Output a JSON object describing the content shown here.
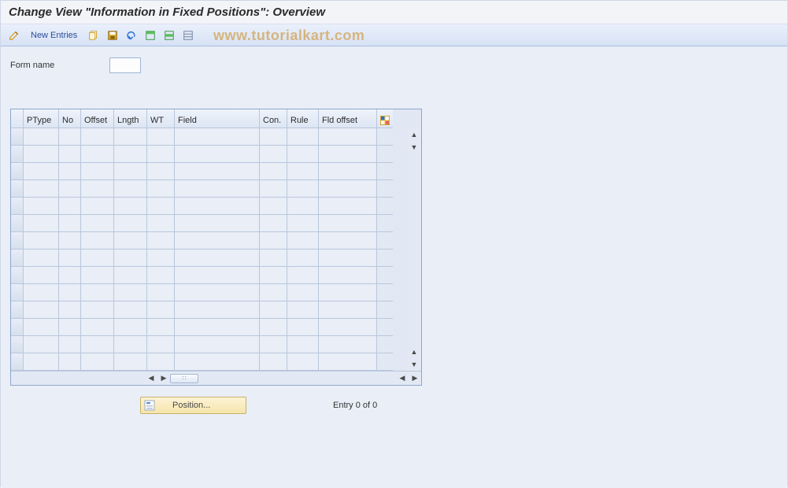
{
  "title": "Change View \"Information in Fixed Positions\": Overview",
  "watermark": "www.tutorialkart.com",
  "toolbar": {
    "new_entries_label": "New Entries"
  },
  "form": {
    "form_name_label": "Form name",
    "form_name_value": ""
  },
  "grid": {
    "columns": [
      "PType",
      "No",
      "Offset",
      "Lngth",
      "WT",
      "Field",
      "Con.",
      "Rule",
      "Fld offset"
    ],
    "row_count": 14
  },
  "footer": {
    "position_label": "Position...",
    "entry_text": "Entry 0 of 0"
  }
}
